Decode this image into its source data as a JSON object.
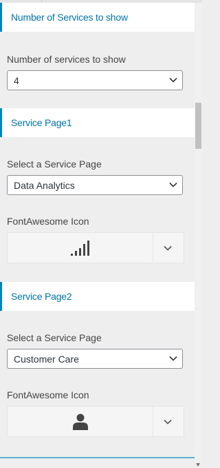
{
  "sections": {
    "count": {
      "title": "Number of Services to show",
      "label": "Number of services to show",
      "value": "4"
    },
    "page1": {
      "title": "Service Page1",
      "select_label": "Select a Service Page",
      "select_value": "Data Analytics",
      "icon_label": "FontAwesome Icon",
      "icon": "signal-icon"
    },
    "page2": {
      "title": "Service Page2",
      "select_label": "Select a Service Page",
      "select_value": "Customer Care",
      "icon_label": "FontAwesome Icon",
      "icon": "user-icon"
    }
  },
  "colors": {
    "accent": "#0073aa",
    "border_accent": "#0085ba",
    "panel_bg": "#eeeeee"
  }
}
